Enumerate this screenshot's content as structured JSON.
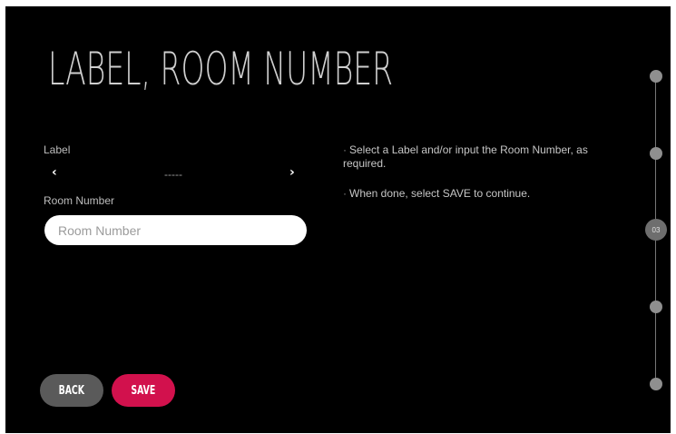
{
  "page": {
    "title": "LABEL, ROOM NUMBER"
  },
  "label_field": {
    "label": "Label",
    "value": "-----",
    "prev_arrow": "‹",
    "next_arrow": "›"
  },
  "room_field": {
    "label": "Room Number",
    "placeholder": "Room Number",
    "value": ""
  },
  "help": {
    "bullet": "·",
    "lines": [
      "Select a Label and/or input the Room Number, as required.",
      "When done, select SAVE to continue."
    ]
  },
  "buttons": {
    "back_label": "BACK",
    "save_label": "SAVE"
  },
  "progress": {
    "current_step_label": "03",
    "current_step": 3,
    "total_steps": 5
  },
  "colors": {
    "background": "#000000",
    "accent": "#d2114d",
    "back_button": "#5a5a5a"
  }
}
